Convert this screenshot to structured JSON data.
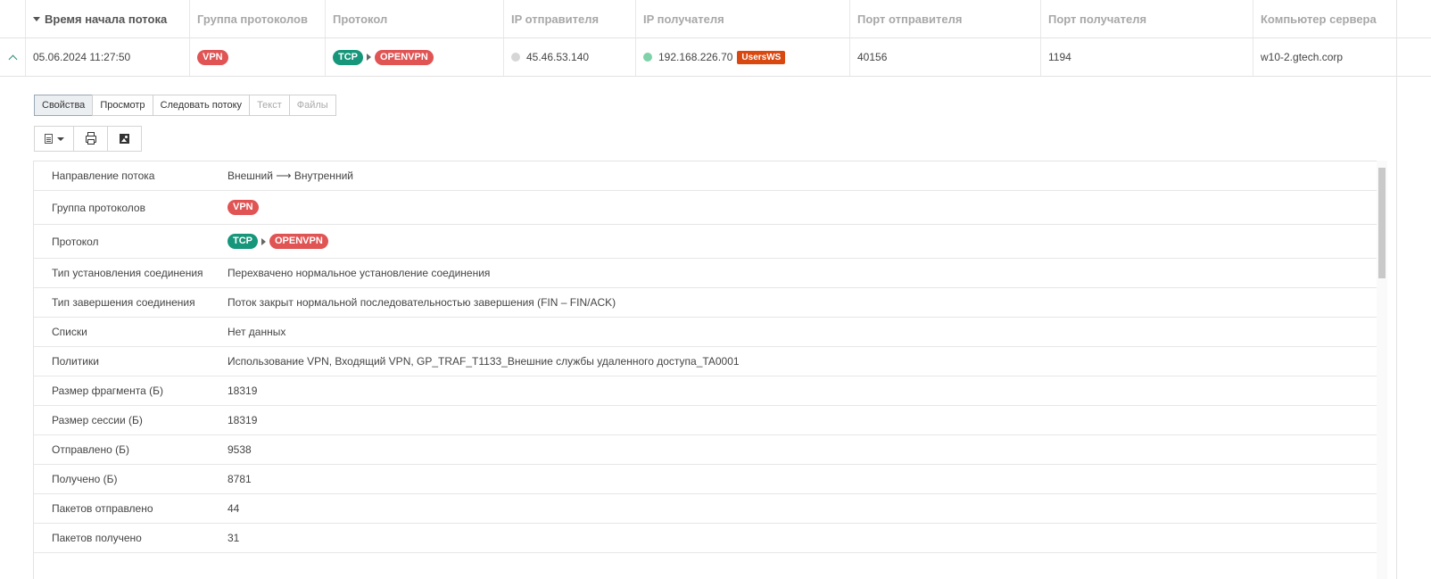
{
  "table": {
    "columns": [
      {
        "label": "Время начала потока",
        "sorted": true
      },
      {
        "label": "Группа протоколов"
      },
      {
        "label": "Протокол"
      },
      {
        "label": "IP отправителя"
      },
      {
        "label": "IP получателя"
      },
      {
        "label": "Порт отправителя"
      },
      {
        "label": "Порт получателя"
      },
      {
        "label": "Компьютер сервера"
      }
    ],
    "row": {
      "start_time": "05.06.2024 11:27:50",
      "protocol_group": "VPN",
      "protocol_base": "TCP",
      "protocol_app": "OPENVPN",
      "src_ip": "45.46.53.140",
      "dst_ip": "192.168.226.70",
      "dst_tag": "UsersWS",
      "src_port": "40156",
      "dst_port": "1194",
      "server_host": "w10-2.gtech.corp"
    }
  },
  "tabs": [
    {
      "label": "Свойства",
      "active": true
    },
    {
      "label": "Просмотр"
    },
    {
      "label": "Следовать потоку"
    },
    {
      "label": "Текст",
      "disabled": true
    },
    {
      "label": "Файлы",
      "disabled": true
    }
  ],
  "toolbar": {
    "icons": [
      "document-icon",
      "print-icon",
      "image-icon"
    ]
  },
  "properties": {
    "direction": {
      "label": "Направление потока",
      "value": "Внешний ⟶ Внутренний"
    },
    "group": {
      "label": "Группа протоколов",
      "value": "VPN"
    },
    "protocol": {
      "label": "Протокол",
      "base": "TCP",
      "app": "OPENVPN"
    },
    "conn_type": {
      "label": "Тип установления соединения",
      "value": "Перехвачено нормальное установление соединения"
    },
    "term_type": {
      "label": "Тип завершения соединения",
      "value": "Поток закрыт нормальной последовательностью завершения (FIN – FIN/ACK)"
    },
    "lists": {
      "label": "Списки",
      "value": "Нет данных"
    },
    "policies": {
      "label": "Политики",
      "value": "Использование VPN, Входящий VPN, GP_TRAF_T1133_Внешние службы удаленного доступа_TA0001"
    },
    "frag_size": {
      "label": "Размер фрагмента (Б)",
      "value": "18319"
    },
    "session_size": {
      "label": "Размер сессии (Б)",
      "value": "18319"
    },
    "sent": {
      "label": "Отправлено (Б)",
      "value": "9538"
    },
    "received": {
      "label": "Получено (Б)",
      "value": "8781"
    },
    "pkts_sent": {
      "label": "Пакетов отправлено",
      "value": "44"
    },
    "pkts_recv": {
      "label": "Пакетов получено",
      "value": "31"
    }
  },
  "colors": {
    "vpn": "#e05454",
    "tcp": "#16967a",
    "tag": "#d9480f",
    "src_dot": "#d6d6d6",
    "dst_dot": "#7fd1a9"
  }
}
